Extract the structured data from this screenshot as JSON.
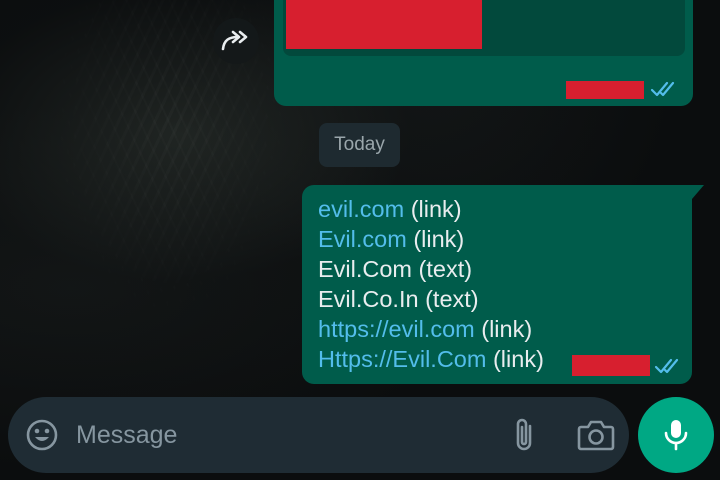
{
  "date_separator": {
    "label": "Today"
  },
  "message": {
    "lines": [
      {
        "link": "evil.com",
        "note": " (link)"
      },
      {
        "link": "Evil.com",
        "note": " (link)"
      },
      {
        "text": "Evil.Com (text)"
      },
      {
        "text": "Evil.Co.In (text)"
      },
      {
        "link": "https://evil.com",
        "note": " (link)"
      },
      {
        "link": "Https://Evil.Com",
        "note": " (link)"
      }
    ],
    "status": "read"
  },
  "composer": {
    "placeholder": "Message"
  },
  "icons": {
    "forward": "forward-arrow-icon",
    "emoji": "emoji-smiley-icon",
    "attach": "paperclip-icon",
    "camera": "camera-icon",
    "mic": "microphone-icon",
    "read_receipt": "double-check-icon"
  },
  "colors": {
    "outgoing_bubble": "#005c4b",
    "link": "#53bdeb",
    "read_ticks": "#53bdeb",
    "mic_button": "#00a884",
    "redaction": "#d71f2f",
    "composer_bg": "#1f2c34"
  }
}
